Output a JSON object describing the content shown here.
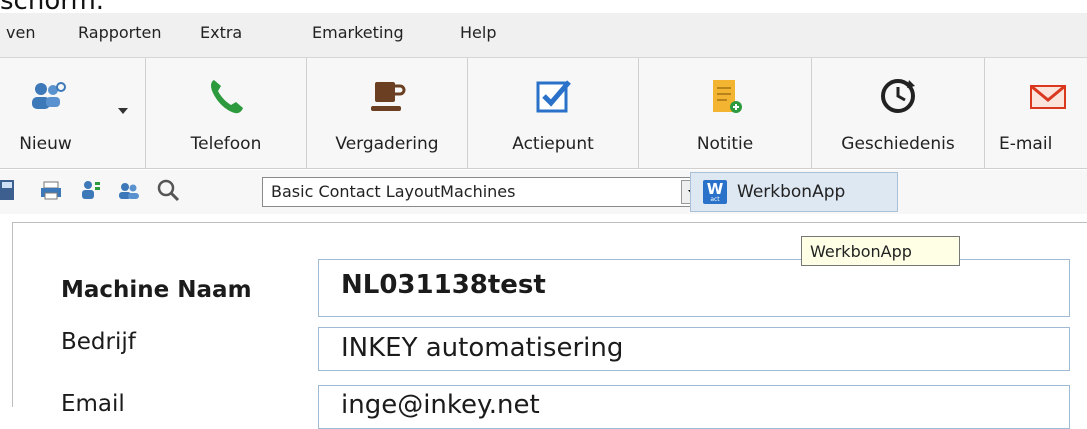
{
  "overlay_text": "schorm.",
  "menu": {
    "items": [
      "ven",
      "Rapporten",
      "Extra",
      "Emarketing",
      "Help"
    ]
  },
  "ribbon": {
    "nieuw": "Nieuw",
    "telefoon": "Telefoon",
    "vergadering": "Vergadering",
    "actiepunt": "Actiepunt",
    "notitie": "Notitie",
    "geschiedenis": "Geschiedenis",
    "email": "E-mail"
  },
  "toolbar": {
    "layout_value": "Basic Contact LayoutMachines",
    "werkbon_label": "WerkbonApp",
    "werkbon_icon_letter": "W",
    "werkbon_icon_sub": "act"
  },
  "tooltip": "WerkbonApp",
  "form": {
    "machine_naam_label": "Machine Naam",
    "machine_naam_value": "NL031138test",
    "bedrijf_label": "Bedrijf",
    "bedrijf_value": "INKEY automatisering",
    "email_label": "Email",
    "email_value": "inge@inkey.net"
  },
  "colors": {
    "phone_green": "#2e9a3e",
    "accent_blue": "#2a71c9",
    "email_red": "#d9381e"
  }
}
